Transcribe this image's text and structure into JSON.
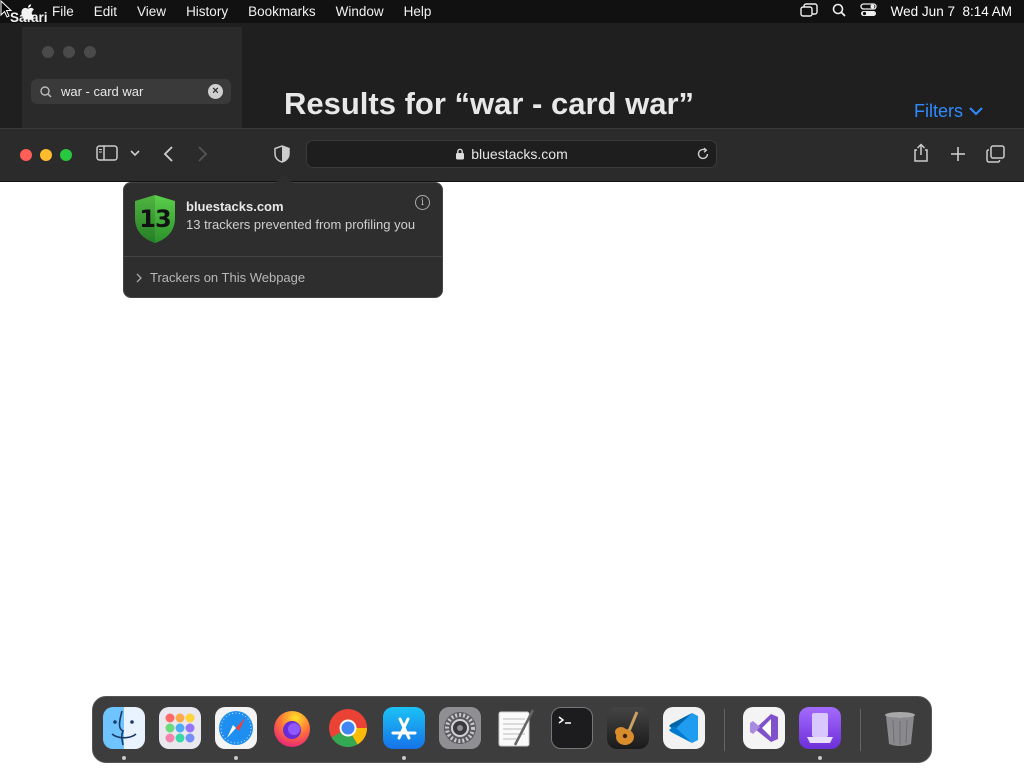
{
  "menubar": {
    "app_name": "Safari",
    "items": [
      "File",
      "Edit",
      "View",
      "History",
      "Bookmarks",
      "Window",
      "Help"
    ],
    "clock": "Wed Jun 7  8:14 AM"
  },
  "background_window": {
    "search_value": "war - card war",
    "results_title": "Results for “war - card war”",
    "filters_label": "Filters"
  },
  "safari": {
    "url": "bluestacks.com"
  },
  "privacy_popover": {
    "tracker_count": "13",
    "site": "bluestacks.com",
    "description": "13 trackers prevented from profiling you",
    "trackers_link": "Trackers on This Webpage"
  },
  "dock": {
    "apps": [
      "finder-icon",
      "launchpad-icon",
      "safari-icon",
      "firefox-icon",
      "chrome-icon",
      "app-store-icon",
      "system-settings-icon",
      "textedit-icon",
      "terminal-icon",
      "garageband-icon",
      "vscode-icon",
      "visual-studio-icon",
      "simulator-icon",
      "trash-icon"
    ]
  },
  "colors": {
    "accent_blue": "#2f8bff",
    "close": "#ff5f57",
    "minimize": "#febc2e",
    "zoom": "#28c840",
    "shield_green": "#3aa83a"
  }
}
